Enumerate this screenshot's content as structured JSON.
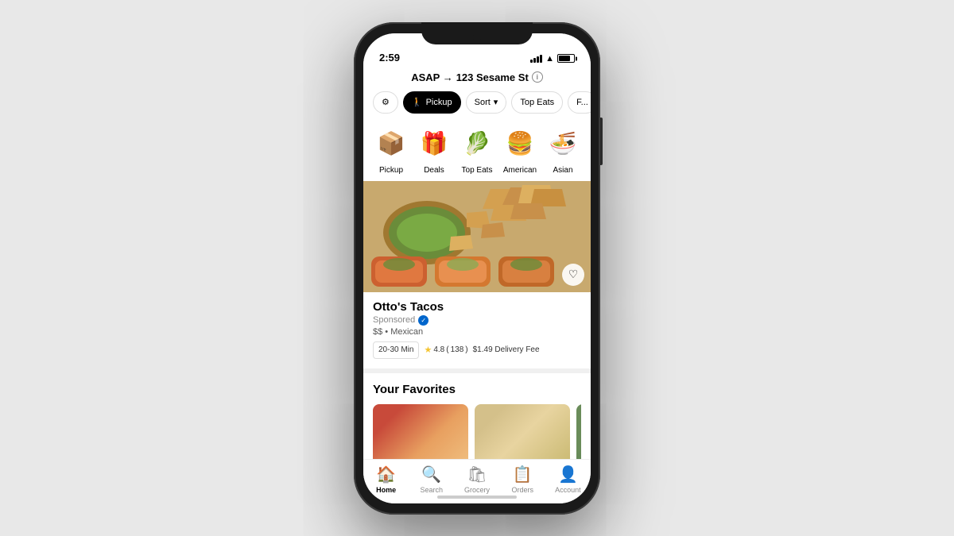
{
  "status_bar": {
    "time": "2:59",
    "battery_level": "75%"
  },
  "address": {
    "prefix": "ASAP →",
    "street": "123 Sesame St",
    "info_icon": "ⓘ"
  },
  "filters": [
    {
      "label": "⚙",
      "type": "icon_only",
      "active": false
    },
    {
      "label": "Pickup",
      "icon": "🚶",
      "active": true
    },
    {
      "label": "Sort",
      "icon": "▾",
      "active": false
    },
    {
      "label": "Top Eats",
      "active": false
    },
    {
      "label": "F...",
      "active": false
    }
  ],
  "categories": [
    {
      "icon": "📦",
      "label": "Pickup"
    },
    {
      "icon": "🎁",
      "label": "Deals"
    },
    {
      "icon": "🥬",
      "label": "Top Eats"
    },
    {
      "icon": "🍔",
      "label": "American"
    },
    {
      "icon": "🍜",
      "label": "Asian"
    }
  ],
  "featured_restaurant": {
    "name": "Otto's Tacos",
    "sponsored_label": "Sponsored",
    "cuisine": "$$ • Mexican",
    "time": "20-30 Min",
    "rating": "4.8",
    "review_count": "138",
    "delivery_fee": "$1.49 Delivery Fee"
  },
  "favorites_section": {
    "title": "Your Favorites"
  },
  "bottom_nav": [
    {
      "icon": "🏠",
      "label": "Home",
      "active": true
    },
    {
      "icon": "🔍",
      "label": "Search",
      "active": false
    },
    {
      "icon": "🛍",
      "label": "Grocery",
      "active": false
    },
    {
      "icon": "📋",
      "label": "Orders",
      "active": false
    },
    {
      "icon": "👤",
      "label": "Account",
      "active": false
    }
  ]
}
